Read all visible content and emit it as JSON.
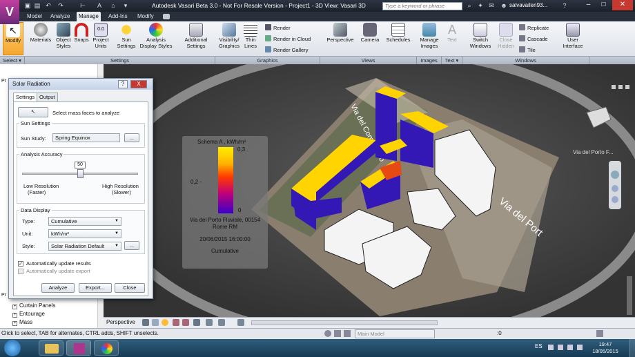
{
  "titlebar": {
    "app_logo": "V",
    "title": "Autodesk Vasari Beta 3.0 - Not For Resale Version -   Project1 - 3D View: Vasari 3D",
    "search_placeholder": "Type a keyword or phrase",
    "user": "salvavailen93..."
  },
  "tabs": [
    "Model",
    "Analyze",
    "Manage",
    "Add-Ins",
    "Modify"
  ],
  "ribbon": {
    "modify": "Modify",
    "materials": "Materials",
    "object_styles": "Object Styles",
    "snaps": "Snaps",
    "project_units": "Project Units",
    "sun_settings": "Sun Settings",
    "analysis_display_styles": "Analysis Display Styles",
    "additional_settings": "Additional Settings",
    "visibility_graphics": "Visibility/ Graphics",
    "thin_lines": "Thin Lines",
    "render": "Render",
    "render_cloud": "Render  in Cloud",
    "render_gallery": "Render  Gallery",
    "perspective": "Perspective",
    "camera": "Camera",
    "schedules": "Schedules",
    "manage_images": "Manage Images",
    "text": "Text",
    "switch_windows": "Switch Windows",
    "close_hidden": "Close Hidden",
    "replicate": "Replicate",
    "cascade": "Cascade",
    "tile": "Tile",
    "user_interface": "User Interface"
  },
  "panels": [
    "Select ▾",
    "Settings",
    "Graphics",
    "Views",
    "Images",
    "Text ▾",
    "Windows"
  ],
  "dialog": {
    "title": "Solar Radiation",
    "help_btn": "?",
    "close_btn": "X",
    "tab_settings": "Settings",
    "tab_output": "Output",
    "select_faces": "Select mass faces to analyze",
    "sun_settings_group": "Sun Settings",
    "sun_study_label": "Sun Study:",
    "sun_study_value": "Spring Equinox",
    "dots": "...",
    "accuracy_group": "Analysis Accuracy",
    "accuracy_value": "50",
    "accuracy_fraction": 0.5,
    "low_res": "Low  Resolution",
    "faster": "(Faster)",
    "high_res": "High Resolution",
    "slower": "(Slower)",
    "data_display_group": "Data Display",
    "type_label": "Type:",
    "type_value": "Cumulative",
    "unit_label": "Unit:",
    "unit_value": "kWh/m²",
    "style_label": "Style:",
    "style_value": "Solar Radiation Default",
    "auto_update_results": "Automatically update results",
    "auto_update_export": "Automatically update export",
    "analyze_btn": "Analyze",
    "export_btn": "Export...",
    "close_label": "Close"
  },
  "legend": {
    "title": "Schema A , kWh/m²",
    "max": "0,3",
    "mid": "0,2 -",
    "min": "0",
    "location1": "Via del Porto Fluviale, 00154",
    "location2": "Rome RM",
    "datetime": "20/06/2015 16:00:00",
    "mode": "Cumulative"
  },
  "viewcube_label": "Via del Porto F...",
  "map_labels": {
    "street1": "Via del Commercio",
    "street2": "Via del Port"
  },
  "tree": [
    "Curtain Panels",
    "Entourage",
    "Mass"
  ],
  "left_tab_letters": [
    "Pr",
    "Pr"
  ],
  "viewbar": {
    "view_name": "Perspective"
  },
  "status": {
    "hint": "Click to select, TAB for alternates, CTRL adds, SHIFT unselects.",
    "model": "Main Model",
    "zero": ":0"
  },
  "taskbar": {
    "lang": "ES",
    "time": "19:47",
    "date": "18/05/2015"
  }
}
